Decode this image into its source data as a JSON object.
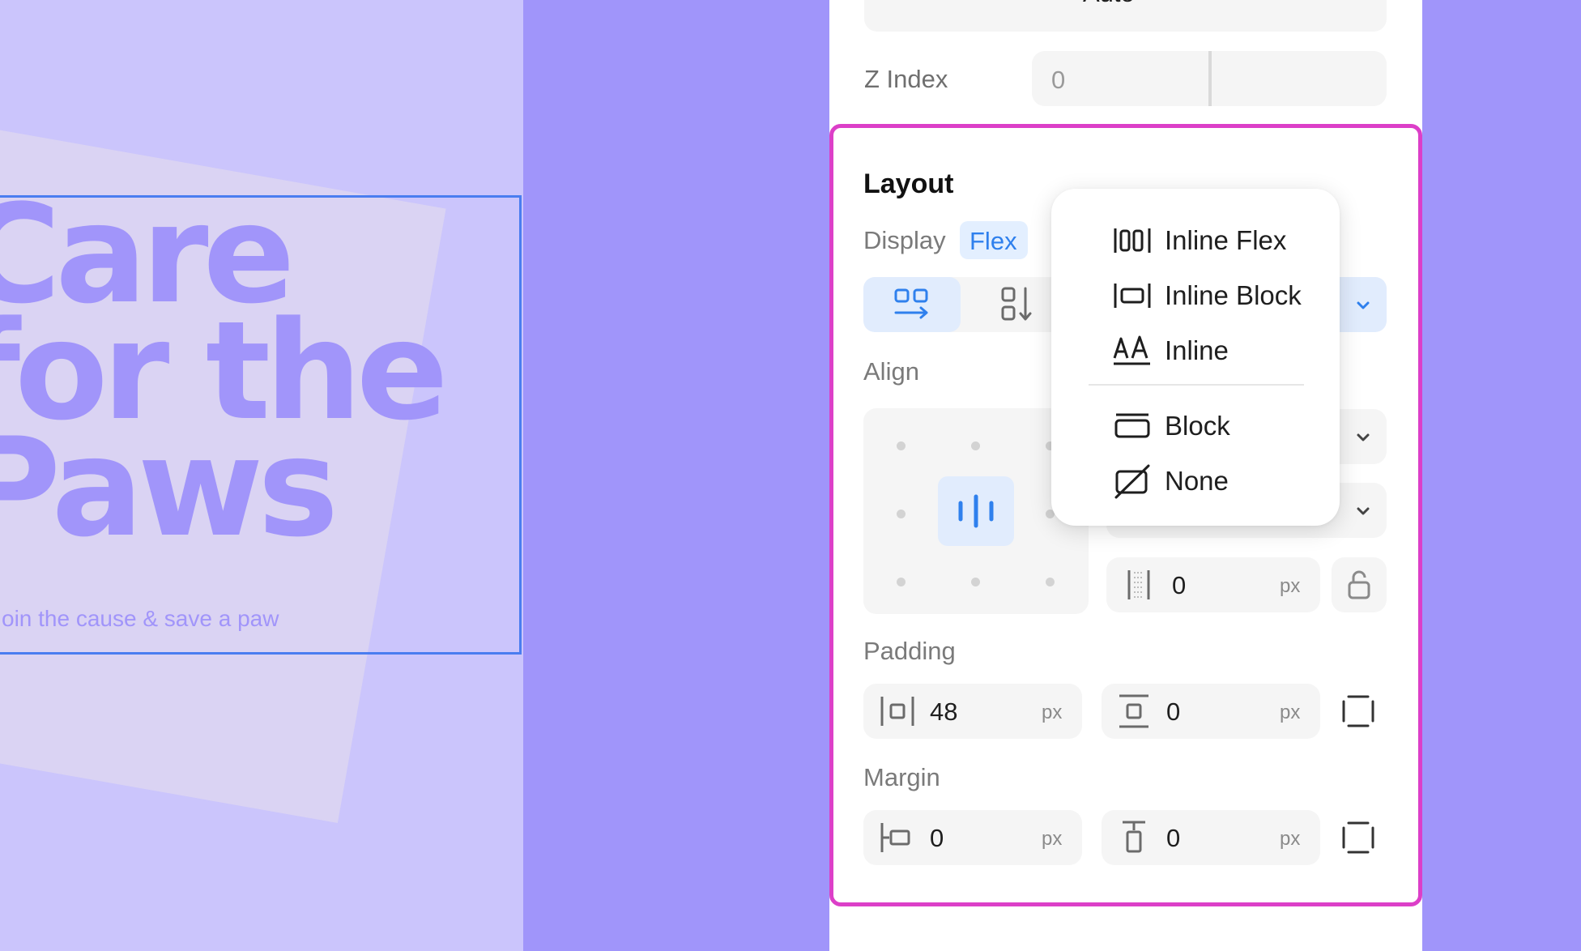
{
  "canvas": {
    "hero_lines": [
      "Care",
      "for the",
      "Paws"
    ],
    "tagline": "Join the cause & save a paw"
  },
  "panel": {
    "top_select_value": "Auto",
    "z_index": {
      "label": "Z Index",
      "value": "0"
    },
    "layout": {
      "title": "Layout",
      "display_label": "Display",
      "display_value": "Flex",
      "direction_buttons": [
        "flex-row-icon",
        "flex-column-icon"
      ],
      "align_label": "Align",
      "gap": {
        "value": "0",
        "unit": "px"
      },
      "padding": {
        "label": "Padding",
        "horizontal": {
          "value": "48",
          "unit": "px"
        },
        "vertical": {
          "value": "0",
          "unit": "px"
        }
      },
      "margin": {
        "label": "Margin",
        "horizontal": {
          "value": "0",
          "unit": "px"
        },
        "vertical": {
          "value": "0",
          "unit": "px"
        }
      }
    }
  },
  "display_menu": {
    "items": [
      {
        "label": "Inline Flex",
        "icon": "inline-flex-icon"
      },
      {
        "label": "Inline Block",
        "icon": "inline-block-icon"
      },
      {
        "label": "Inline",
        "icon": "inline-text-icon"
      },
      {
        "label": "Block",
        "icon": "block-icon"
      },
      {
        "label": "None",
        "icon": "display-none-icon"
      }
    ]
  },
  "colors": {
    "accent": "#2f80ed",
    "highlight": "#dc3fc8",
    "canvas_purple": "#a095fa",
    "canvas_light": "#cbc5fc"
  }
}
